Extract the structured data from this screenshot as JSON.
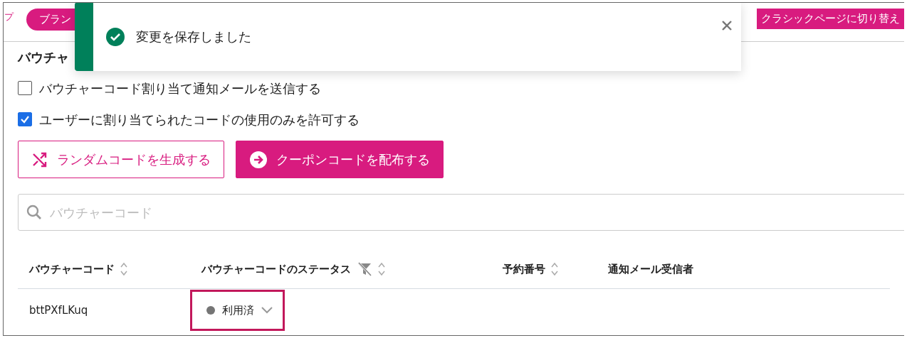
{
  "edge_link": "プ",
  "plan_pill": "ブラン",
  "classic_button": "クラシックページに切り替え",
  "section_title": "バウチャ",
  "options": [
    {
      "label": "バウチャーコード割り当て通知メールを送信する",
      "checked": false
    },
    {
      "label": "ユーザーに割り当てられたコードの使用のみを許可する",
      "checked": true
    }
  ],
  "buttons": [
    {
      "kind": "outline",
      "label": "ランダムコードを生成する"
    },
    {
      "kind": "filled",
      "label": "クーポンコードを配布する"
    }
  ],
  "search": {
    "placeholder": "バウチャーコード"
  },
  "table": {
    "columns": [
      {
        "label": "バウチャーコード",
        "sortable": true,
        "filter": false
      },
      {
        "label": "バウチャーコードのステータス",
        "sortable": true,
        "filter": true
      },
      {
        "label": "予約番号",
        "sortable": true,
        "filter": false
      },
      {
        "label": "通知メール受信者",
        "sortable": false,
        "filter": false
      }
    ],
    "rows": [
      {
        "code": "bttPXfLKuq",
        "status": "利用済",
        "color": "#757575",
        "highlighted": true
      }
    ]
  },
  "toast": {
    "message": "変更を保存しました",
    "kind": "success"
  }
}
